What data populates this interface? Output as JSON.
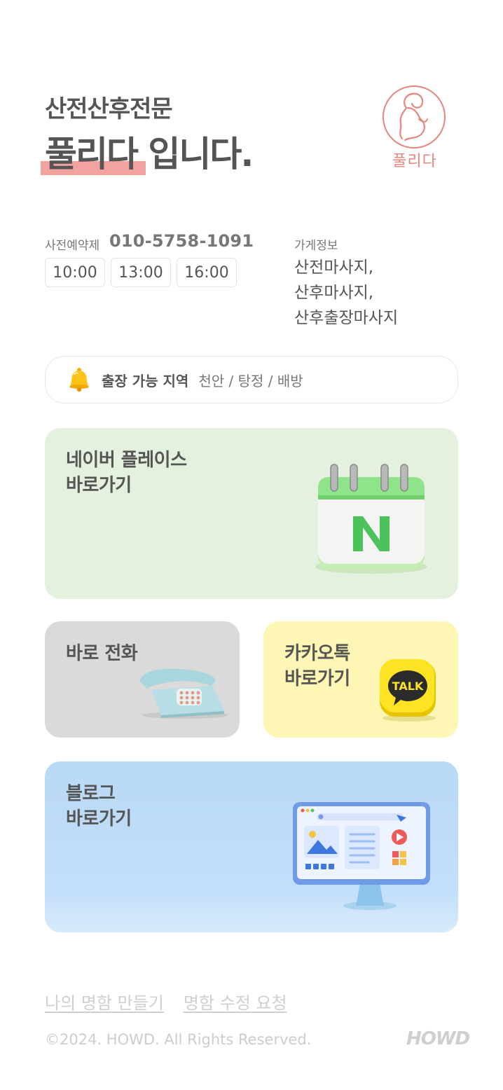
{
  "header": {
    "subtitle": "산전산후전문",
    "brand": "풀리다",
    "suffix": " 입니다.",
    "logo_text": "풀리다"
  },
  "info": {
    "reserve_label": "사전예약제",
    "phone": "010-5758-1091",
    "times": [
      "10:00",
      "13:00",
      "16:00"
    ],
    "store_label": "가게정보",
    "store_items": [
      "산전마사지,",
      "산후마사지,",
      "산후출장마사지"
    ]
  },
  "area": {
    "icon": "bell-icon",
    "label": "출장 가능 지역",
    "value": "천안 / 탕정 / 배방"
  },
  "cards": {
    "naver": {
      "title": "네이버 플레이스\n바로가기",
      "icon": "naver-calendar-icon"
    },
    "call": {
      "title": "바로 전화",
      "icon": "telephone-icon"
    },
    "kakao": {
      "title": "카카오톡\n바로가기",
      "icon": "kakaotalk-icon",
      "icon_text": "TALK"
    },
    "blog": {
      "title": "블로그\n바로가기",
      "icon": "monitor-icon"
    }
  },
  "footer": {
    "links": [
      "나의 명함 만들기",
      "명함 수정 요청"
    ],
    "copyright": "©2024. HOWD. All Rights Reserved.",
    "brand": "HOWD"
  },
  "colors": {
    "accent": "#f2a3a0",
    "logo": "#e8867e",
    "naver_card": "#e4f1de",
    "call_card": "#dadada",
    "kakao_card": "#fdf6b4",
    "blog_card": "#b9d9f5"
  }
}
